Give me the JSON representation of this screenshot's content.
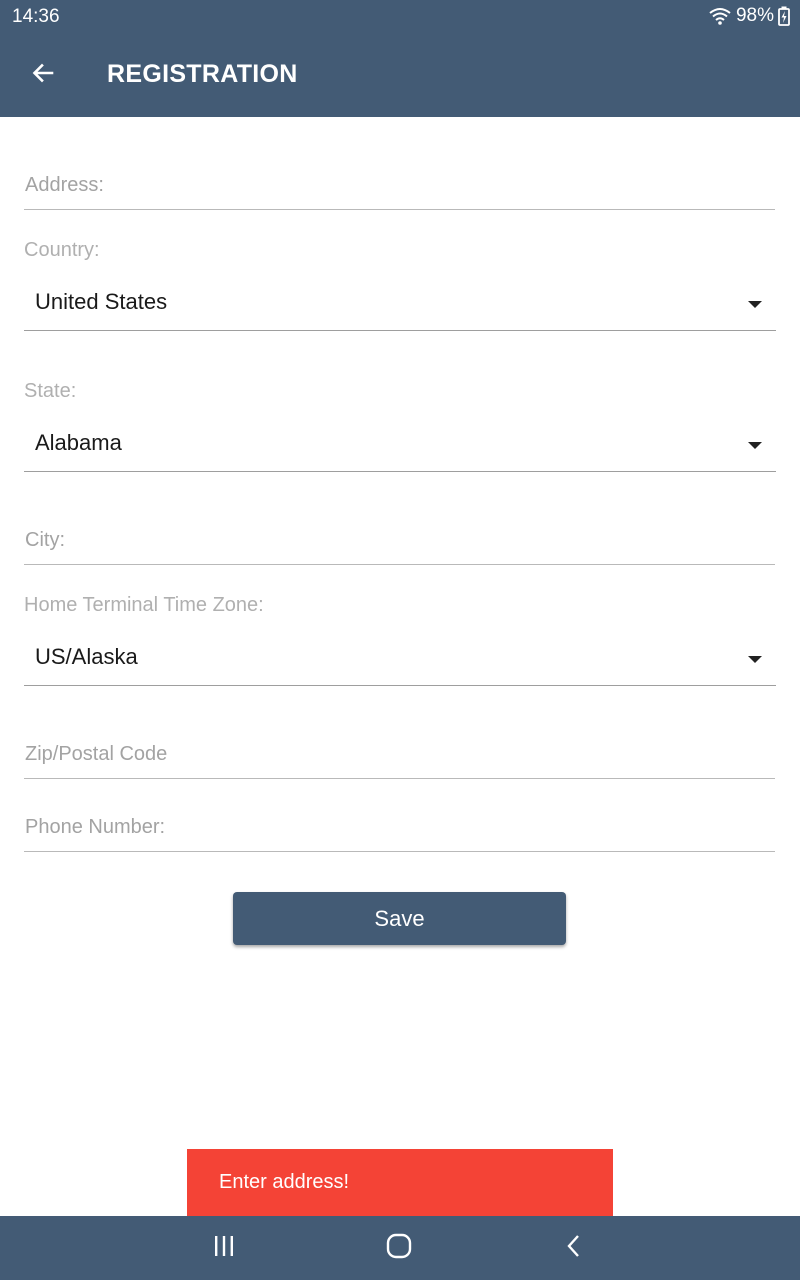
{
  "status_bar": {
    "time": "14:36",
    "battery": "98%",
    "wifi_icon": "wifi-icon",
    "battery_icon": "battery-charging-icon"
  },
  "app_bar": {
    "title": "REGISTRATION",
    "back_icon": "arrow-back-icon"
  },
  "form": {
    "address": {
      "placeholder": "Address:",
      "value": ""
    },
    "country": {
      "label": "Country:",
      "value": "United States"
    },
    "state": {
      "label": "State:",
      "value": "Alabama"
    },
    "city": {
      "placeholder": "City:",
      "value": ""
    },
    "time_zone": {
      "label": "Home Terminal Time Zone:",
      "value": "US/Alaska"
    },
    "zip": {
      "placeholder": "Zip/Postal Code",
      "value": ""
    },
    "phone": {
      "placeholder": "Phone Number:",
      "value": ""
    },
    "save_label": "Save"
  },
  "toast": {
    "message": "Enter address!"
  },
  "nav_bar": {
    "recents_icon": "recent-apps-icon",
    "home_icon": "home-icon",
    "back_icon": "nav-back-icon"
  },
  "colors": {
    "primary": "#435b75",
    "toast": "#f44336",
    "placeholder": "#a3a3a3"
  }
}
